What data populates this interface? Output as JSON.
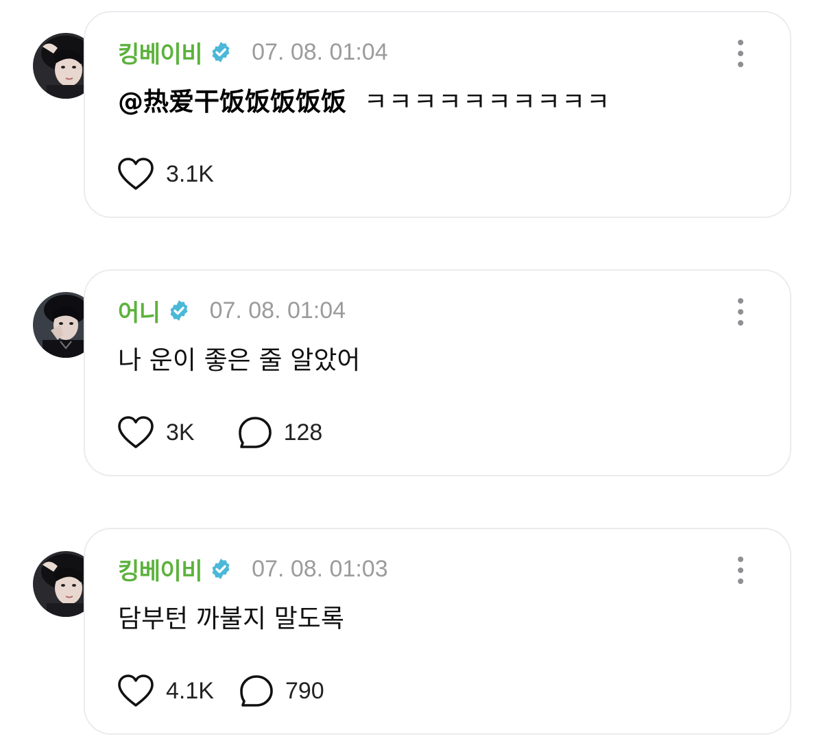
{
  "posts": [
    {
      "username": "킹베이비",
      "timestamp": "07. 08. 01:04",
      "mention": "@热爱干饭饭饭饭饭",
      "text": "ㅋㅋㅋㅋㅋㅋㅋㅋㅋㅋ",
      "likes": "3.1K",
      "replies": null,
      "avatar": "avatar-image-1"
    },
    {
      "username": "어니",
      "timestamp": "07. 08. 01:04",
      "mention": "",
      "text": "나 운이 좋은 줄 알았어",
      "likes": "3K",
      "replies": "128",
      "avatar": "avatar-image-2"
    },
    {
      "username": "킹베이비",
      "timestamp": "07. 08. 01:03",
      "mention": "",
      "text": "담부턴 까불지 말도록",
      "likes": "4.1K",
      "replies": "790",
      "avatar": "avatar-image-1"
    }
  ],
  "icons": {
    "verified": "verified-badge-icon",
    "more": "more-options-icon",
    "like": "heart-icon",
    "reply": "reply-bubble-icon"
  },
  "colors": {
    "username": "#5cb23c",
    "verified": "#4bb8d8",
    "timestamp": "#9b9b9b",
    "card_border": "#ebebef"
  }
}
